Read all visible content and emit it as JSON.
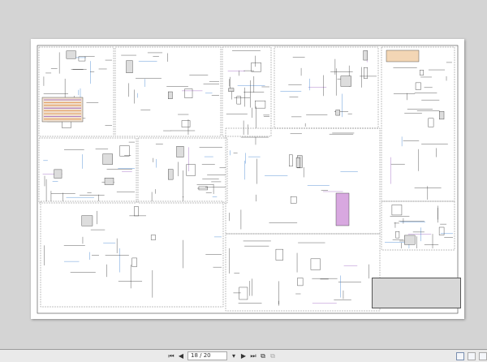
{
  "document": {
    "type": "wiring schematic",
    "title_block_text": "unreadable"
  },
  "toolbar": {
    "first_page_icon": "first-page-icon",
    "prev_page_icon": "prev-page-icon",
    "page_indicator": "18 / 20",
    "next_page_icon": "next-page-icon",
    "last_page_icon": "last-page-icon"
  },
  "colors": {
    "wire_blue": "#3a7fd0",
    "wire_purple": "#9a5fc0",
    "wire_orange": "#e08a3a",
    "line": "#333333"
  }
}
